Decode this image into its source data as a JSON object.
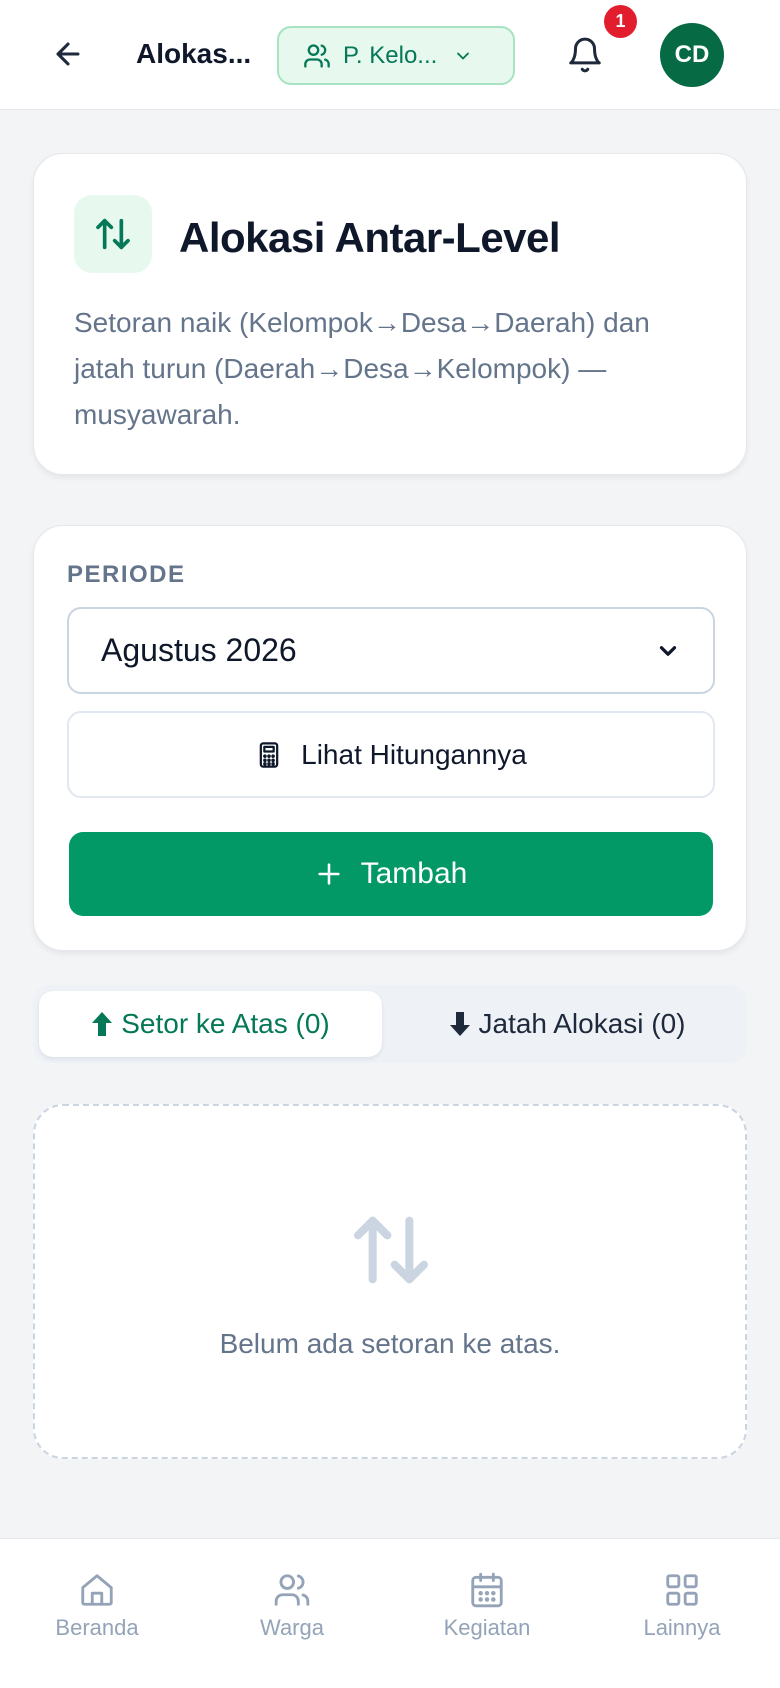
{
  "header": {
    "title": "Alokas...",
    "scope_label": "P. Kelo...",
    "notification_count": "1",
    "avatar_initials": "CD"
  },
  "intro": {
    "title": "Alokasi Antar-Level",
    "description": "Setoran naik (Kelompok→Desa→Daerah) dan jatah turun (Daerah→Desa→Kelompok) — musyawarah."
  },
  "period": {
    "label": "PERIODE",
    "selected": "Agustus 2026",
    "calc_button": "Lihat Hitungannya",
    "add_button": "Tambah"
  },
  "tabs": [
    {
      "label": "Setor ke Atas (0)",
      "active": true
    },
    {
      "label": "Jatah Alokasi (0)",
      "active": false
    }
  ],
  "empty_state": {
    "text": "Belum ada setoran ke atas."
  },
  "bottom_nav": [
    {
      "label": "Beranda",
      "icon": "home-icon"
    },
    {
      "label": "Warga",
      "icon": "users-icon"
    },
    {
      "label": "Kegiatan",
      "icon": "calendar-icon"
    },
    {
      "label": "Lainnya",
      "icon": "grid-icon"
    }
  ],
  "colors": {
    "primary": "#039966",
    "primary_dark": "#066b45",
    "primary_light": "#e7f8ef",
    "badge": "#e11d2e",
    "muted": "#64748b"
  }
}
